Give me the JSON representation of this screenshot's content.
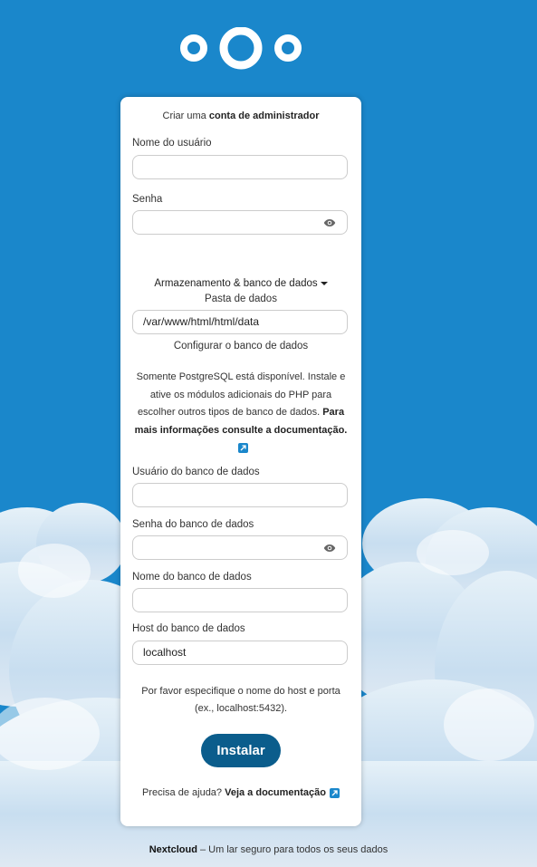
{
  "logo": {
    "icon": "nextcloud-logo-icon"
  },
  "form": {
    "heading_prefix": "Criar uma",
    "heading_strong": "conta de administrador",
    "username_label": "Nome do usuário",
    "username_value": "",
    "password_label": "Senha",
    "password_value": "",
    "storage_toggle": "Armazenamento & banco de dados",
    "data_folder_label": "Pasta de dados",
    "data_folder_value": "/var/www/html/html/data",
    "configure_db": "Configurar o banco de dados",
    "db_info_text": "Somente PostgreSQL está disponível. Instale e ative os módulos adicionais do PHP para escolher outros tipos de banco de dados.",
    "db_info_link": "Para mais informações consulte a documentação.",
    "db_user_label": "Usuário do banco de dados",
    "db_user_value": "",
    "db_password_label": "Senha do banco de dados",
    "db_password_value": "",
    "db_name_label": "Nome do banco de dados",
    "db_name_value": "",
    "db_host_label": "Host do banco de dados",
    "db_host_value": "localhost",
    "host_hint": "Por favor especifique o nome do host e porta (ex., localhost:5432).",
    "install_button": "Instalar",
    "help_prefix": "Precisa de ajuda?",
    "help_link": "Veja a documentação"
  },
  "footer": {
    "brand": "Nextcloud",
    "tagline": "– Um lar seguro para todos os seus dados"
  },
  "colors": {
    "background": "#1a87cb",
    "button": "#0b5d8c",
    "card": "#ffffff"
  }
}
